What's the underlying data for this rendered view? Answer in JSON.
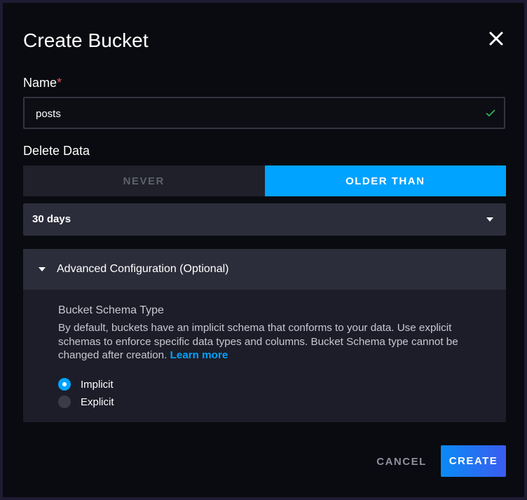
{
  "modal": {
    "title": "Create Bucket",
    "close_icon": "close-icon"
  },
  "name_field": {
    "label": "Name",
    "required_mark": "*",
    "value": "posts",
    "valid": true,
    "valid_icon": "check-icon",
    "valid_color": "#34bb55"
  },
  "delete_data": {
    "label": "Delete Data",
    "options": [
      {
        "label": "NEVER",
        "selected": false
      },
      {
        "label": "OLDER THAN",
        "selected": true
      }
    ],
    "retention": {
      "selected": "30 days",
      "caret_icon": "chevron-down-icon"
    }
  },
  "advanced": {
    "title": "Advanced Configuration (Optional)",
    "expanded": true,
    "toggle_icon": "caret-down-icon",
    "schema_type": {
      "title": "Bucket Schema Type",
      "description": "By default, buckets have an implicit schema that conforms to your data. Use explicit schemas to enforce specific data types and columns. Bucket Schema type cannot be changed after creation.",
      "learn_more": "Learn more",
      "options": [
        {
          "label": "Implicit",
          "checked": true
        },
        {
          "label": "Explicit",
          "checked": false
        }
      ]
    }
  },
  "footer": {
    "cancel_label": "CANCEL",
    "create_label": "CREATE"
  },
  "colors": {
    "accent": "#00a3ff",
    "modal_bg": "#0a0b10",
    "required": "#dc4e58"
  }
}
